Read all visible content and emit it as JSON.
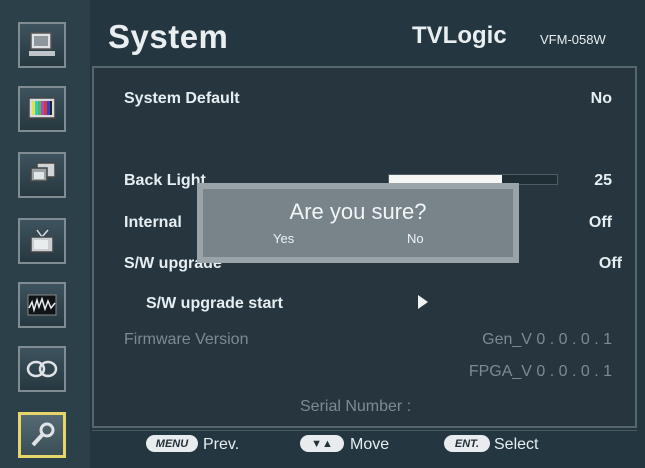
{
  "header": {
    "title": "System",
    "brand": "TVLogic",
    "model": "VFM-058W"
  },
  "sidebar": {
    "items": [
      {
        "name": "monitor-icon"
      },
      {
        "name": "color-bars-icon"
      },
      {
        "name": "screens-icon"
      },
      {
        "name": "tv-icon"
      },
      {
        "name": "waveform-icon"
      },
      {
        "name": "loop-icon"
      },
      {
        "name": "tools-icon",
        "active": true
      }
    ]
  },
  "menu": {
    "system_default": {
      "label": "System Default",
      "value": "No"
    },
    "back_light": {
      "label": "Back Light",
      "value": "25",
      "level_fraction": 0.67
    },
    "internal": {
      "label": "Internal",
      "value": "Off"
    },
    "sw_upgrade": {
      "label": "S/W upgrade",
      "value": "Off"
    },
    "sw_upgrade_start": {
      "label": "S/W upgrade start"
    },
    "firmware": {
      "label": "Firmware Version",
      "gen": "Gen_V 0 . 0 . 0 . 1",
      "fpga": "FPGA_V 0 . 0 . 0 . 1"
    },
    "serial": {
      "label": "Serial Number :"
    }
  },
  "dialog": {
    "title": "Are you sure?",
    "yes": "Yes",
    "no": "No"
  },
  "footer": {
    "prev_key": "MENU",
    "prev_label": "Prev.",
    "move_key": "▼▲",
    "move_label": "Move",
    "select_key": "ENT.",
    "select_label": "Select"
  },
  "colors": {
    "accent_active": "#e6d56a",
    "background": "#24363f",
    "text": "#e6eef1"
  }
}
